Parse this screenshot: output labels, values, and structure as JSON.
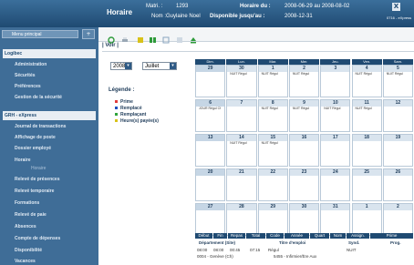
{
  "header": {
    "title": "Horaire",
    "matri_label": "Matri. :",
    "matri_value": "1293",
    "nom_label": "Nom :",
    "nom_value": "Guylaine Noel",
    "horaire_du_label": "Horaire du :",
    "horaire_du_value": "2008-06-29 au 2008-08-02",
    "disponible_label": "Disponible jusqu'au :",
    "disponible_value": "2008-12-31",
    "user_small": "0716 - eXpress",
    "close": "X"
  },
  "sidebar": {
    "menu_select": "Menu principal",
    "menu_btn": "+",
    "section1": "Logibec",
    "section1_items": [
      "Administration",
      "Sécurités",
      "Préférences",
      "Gestion de la sécurité"
    ],
    "section2": "GRH - eXpress",
    "section2_items": [
      "Journal de transactions",
      "Affichage de poste",
      "Dossier employé",
      "Horaire",
      "Relevé de présences",
      "Relevé temporaire",
      "Formations",
      "Relevé de paie",
      "Absences",
      "Compte de dépenses",
      "Disponibilité",
      "Vacances"
    ],
    "sub_item": "Horaire"
  },
  "tabs": [
    "| Voir |"
  ],
  "filters": {
    "year": "2008",
    "month": "Juillet"
  },
  "legend": {
    "title": "Légende :",
    "items": [
      {
        "label": "Prime",
        "color": "#e23b3b"
      },
      {
        "label": "Remplacé",
        "color": "#1f4fbf"
      },
      {
        "label": "Remplaçant",
        "color": "#2fa33b"
      },
      {
        "label": "Heure(s) payée(s)",
        "color": "#d9c21a"
      }
    ]
  },
  "calendar": {
    "days": [
      "Dim.",
      "Lun.",
      "Mar.",
      "Mer.",
      "Jeu.",
      "Ven.",
      "Sam."
    ],
    "weeks": [
      [
        {
          "d": "29",
          "t": ""
        },
        {
          "d": "30",
          "t": "NUIT Régul"
        },
        {
          "d": "1",
          "t": "NUIT Régul"
        },
        {
          "d": "2",
          "t": "NUIT Régul"
        },
        {
          "d": "3",
          "t": ""
        },
        {
          "d": "4",
          "t": "NUIT Régul"
        },
        {
          "d": "5",
          "t": "NUIT Régul"
        }
      ],
      [
        {
          "d": "6",
          "t": "JOUR Régul Cf"
        },
        {
          "d": "7",
          "t": ""
        },
        {
          "d": "8",
          "t": "NUIT Régul"
        },
        {
          "d": "9",
          "t": "NUIT Régul"
        },
        {
          "d": "10",
          "t": "NUIT Régul"
        },
        {
          "d": "11",
          "t": "NUIT Régul"
        },
        {
          "d": "12",
          "t": ""
        }
      ],
      [
        {
          "d": "13",
          "t": ""
        },
        {
          "d": "14",
          "t": "NUIT Régul"
        },
        {
          "d": "15",
          "t": "NUIT Régul"
        },
        {
          "d": "16",
          "t": ""
        },
        {
          "d": "17",
          "t": ""
        },
        {
          "d": "18",
          "t": ""
        },
        {
          "d": "19",
          "t": ""
        }
      ],
      [
        {
          "d": "20",
          "t": ""
        },
        {
          "d": "21",
          "t": ""
        },
        {
          "d": "22",
          "t": ""
        },
        {
          "d": "23",
          "t": ""
        },
        {
          "d": "24",
          "t": ""
        },
        {
          "d": "25",
          "t": ""
        },
        {
          "d": "26",
          "t": ""
        }
      ],
      [
        {
          "d": "27",
          "t": ""
        },
        {
          "d": "28",
          "t": ""
        },
        {
          "d": "29",
          "t": ""
        },
        {
          "d": "30",
          "t": ""
        },
        {
          "d": "31",
          "t": ""
        },
        {
          "d": "1",
          "t": ""
        },
        {
          "d": "2",
          "t": ""
        }
      ]
    ]
  },
  "details": {
    "headers": [
      "Début",
      "Fin",
      "Repas",
      "Total",
      "Code",
      "Année",
      "Quart",
      "Nom",
      "Assign.",
      "Prime"
    ],
    "sub_headers": [
      "Département (Site)",
      "Titre d'emploi",
      "Synd.",
      "Prog."
    ],
    "row1": [
      "08:00",
      "08:00",
      "00:45",
      "07:15",
      "Régul",
      "NUIT"
    ],
    "row2": [
      "0004 - Genève (Ch)",
      "5455 - Infirmier/Ère Aux"
    ]
  }
}
